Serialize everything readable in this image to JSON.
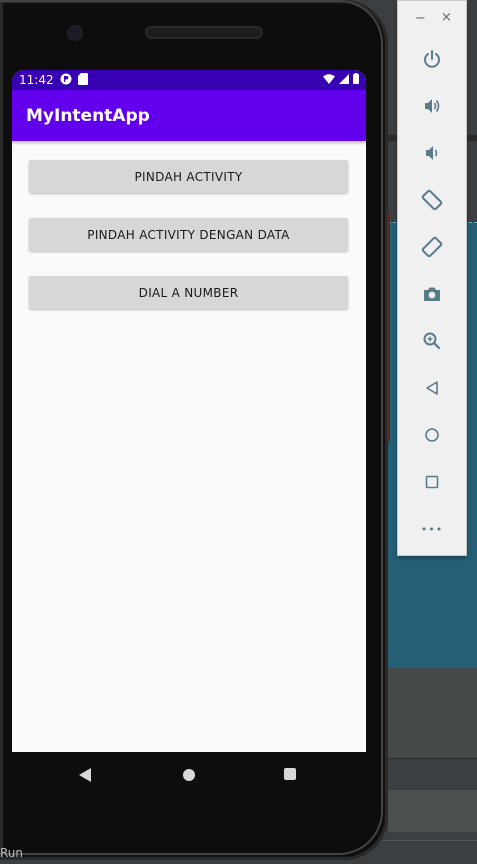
{
  "status_bar": {
    "time": "11:42"
  },
  "app": {
    "title": "MyIntentApp"
  },
  "buttons": [
    {
      "label": "PINDAH ACTIVITY"
    },
    {
      "label": "PINDAH ACTIVITY DENGAN DATA"
    },
    {
      "label": "DIAL A NUMBER"
    }
  ],
  "emulator": {
    "minimize": "−",
    "close": "×",
    "more": "•••"
  },
  "ide": {
    "bottom_text": "Run"
  },
  "colors": {
    "status_bar": "#3700b3",
    "app_bar": "#6200ee",
    "button_bg": "#d6d7d7",
    "screen_bg": "#fafafa",
    "toolbar_icon": "#5b7b8b"
  },
  "icons": {
    "power": "power-icon",
    "volume_up": "volume-up-icon",
    "volume_down": "volume-down-icon",
    "rotate_left": "rotate-left-icon",
    "rotate_right": "rotate-right-icon",
    "screenshot": "camera-icon",
    "zoom": "zoom-icon",
    "back": "back-icon",
    "home": "home-icon",
    "overview": "overview-icon"
  }
}
